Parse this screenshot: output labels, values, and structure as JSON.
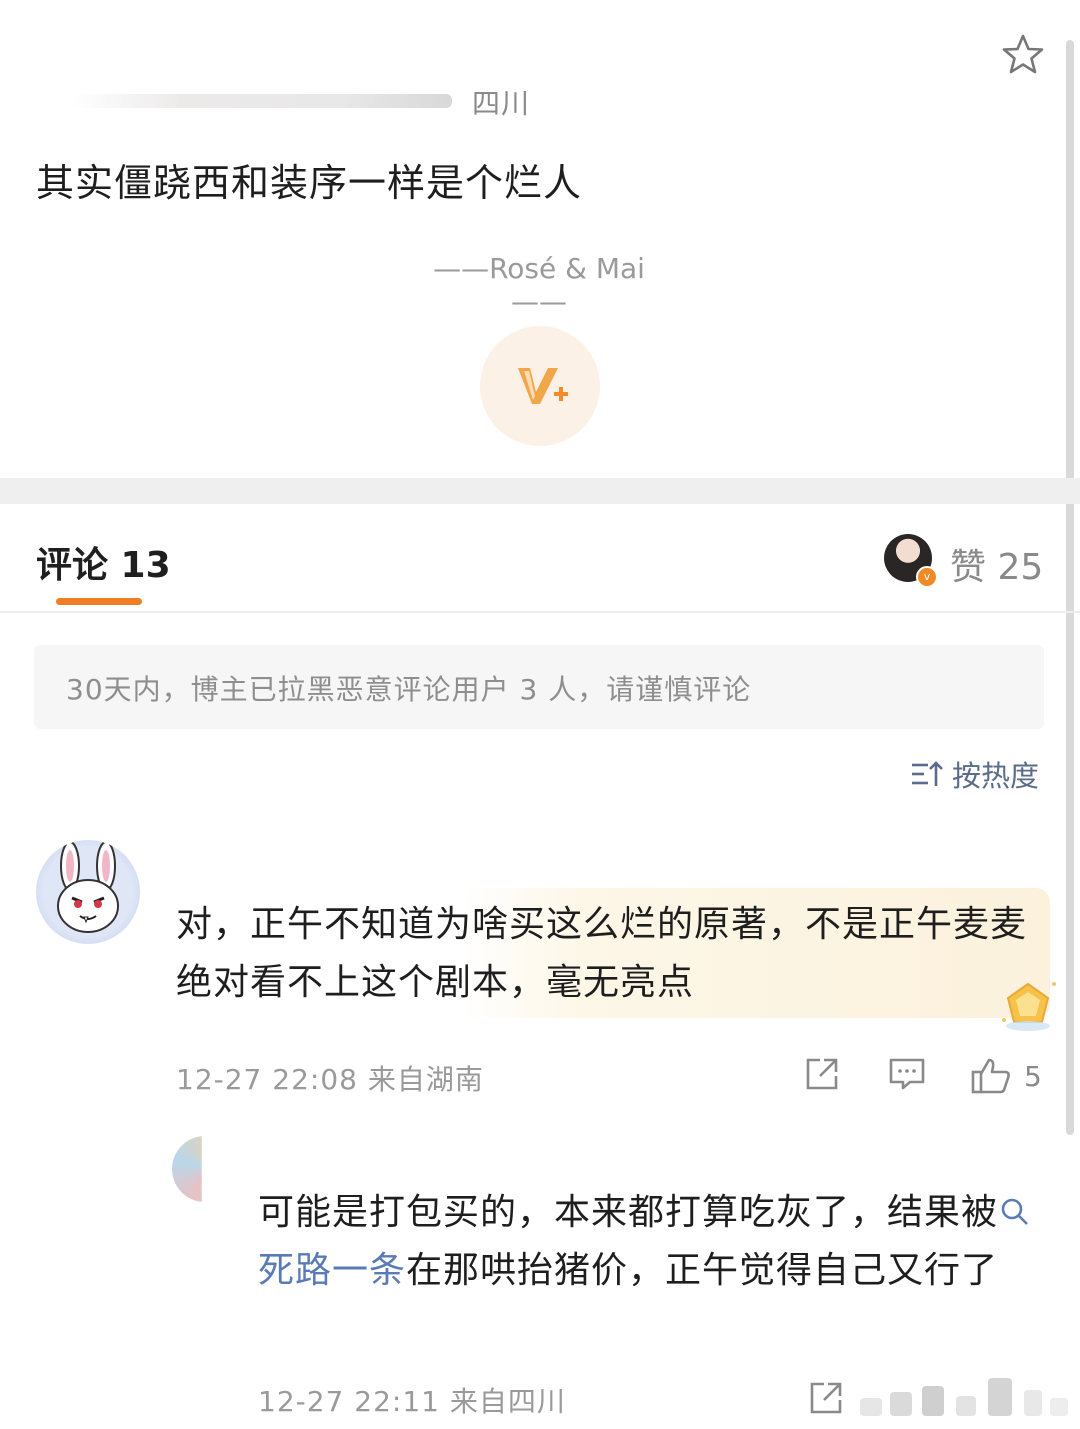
{
  "post": {
    "location": "四川",
    "text": "其实僵跷西和装序一样是个烂人",
    "signature": "——Rosé & Mai——"
  },
  "comments_header": {
    "tab_label": "评论 13",
    "likes_label": "赞 25"
  },
  "notice": {
    "text": "30天内，博主已拉黑恶意评论用户 3 人，请谨慎评论"
  },
  "sort": {
    "label": "按热度"
  },
  "comments": [
    {
      "text": "对，正午不知道为啥买这么烂的原著，不是正午麦麦绝对看不上这个剧本，毫无亮点",
      "meta": "12-27 22:08 来自湖南",
      "like_count": "5"
    },
    {
      "text_before": "可能是打包买的，本来都打算吃灰了，结果被",
      "link": "死路一条",
      "text_after": "在那哄抬猪价，正午觉得自己又行了",
      "meta": "12-27 22:11 来自四川"
    }
  ],
  "colors": {
    "accent": "#f07e24",
    "link": "#5a7bb5",
    "muted": "#9a9a9a"
  },
  "icons": [
    "star-icon",
    "vplus-icon",
    "sort-icon",
    "share-icon",
    "reply-icon",
    "thumbs-up-icon",
    "search-icon"
  ]
}
